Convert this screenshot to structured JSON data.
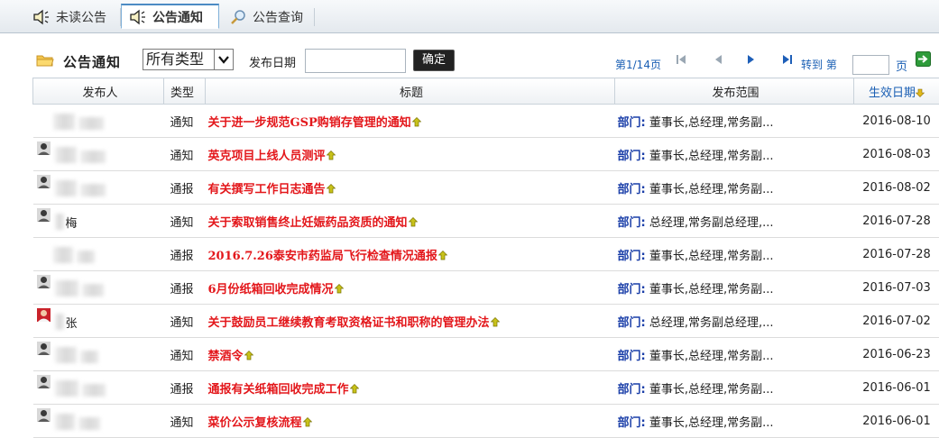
{
  "tabs": [
    {
      "label": "未读公告",
      "icon": "speaker-icon",
      "active": false
    },
    {
      "label": "公告通知",
      "icon": "speaker-icon",
      "active": true
    },
    {
      "label": "公告查询",
      "icon": "search-icon",
      "active": false
    }
  ],
  "toolbar": {
    "section_title": "公告通知",
    "type_select_value": "所有类型",
    "date_label": "发布日期",
    "date_value": "",
    "confirm_label": "确定",
    "page_info": "第1/14页",
    "goto_label": "转到 第",
    "page_value": "",
    "page_suffix": "页"
  },
  "table": {
    "headers": {
      "publisher": "发布人",
      "type": "类型",
      "title": "标题",
      "range": "发布范围",
      "date": "生效日期"
    },
    "rows": [
      {
        "publisher": "",
        "avatar": false,
        "type": "通知",
        "title": "关于进一步规范GSP购销存管理的通知",
        "range_label": "部门:",
        "range": "董事长,总经理,常务副...",
        "date": "2016-08-10"
      },
      {
        "publisher": "",
        "avatar": true,
        "type": "通知",
        "title": "英克项目上线人员测评",
        "range_label": "部门:",
        "range": "董事长,总经理,常务副...",
        "date": "2016-08-03"
      },
      {
        "publisher": "",
        "avatar": true,
        "type": "通报",
        "title": "有关撰写工作日志通告",
        "range_label": "部门:",
        "range": "董事长,总经理,常务副...",
        "date": "2016-08-02"
      },
      {
        "publisher": "梅",
        "avatar": true,
        "type": "通知",
        "title": "关于索取销售终止妊娠药品资质的通知",
        "range_label": "部门:",
        "range": "总经理,常务副总经理,...",
        "date": "2016-07-28"
      },
      {
        "publisher": "",
        "avatar": false,
        "type": "通报",
        "title": "2016.7.26泰安市药监局飞行检查情况通报",
        "range_label": "部门:",
        "range": "董事长,总经理,常务副...",
        "date": "2016-07-28"
      },
      {
        "publisher": "",
        "avatar": true,
        "type": "通报",
        "title": "6月份纸箱回收完成情况",
        "range_label": "部门:",
        "range": "董事长,总经理,常务副...",
        "date": "2016-07-03"
      },
      {
        "publisher": "张",
        "avatar": true,
        "type": "通知",
        "title": "关于鼓励员工继续教育考取资格证书和职称的管理办法",
        "range_label": "部门:",
        "range": "总经理,常务副总经理,...",
        "date": "2016-07-02"
      },
      {
        "publisher": "",
        "avatar": true,
        "type": "通知",
        "title": "禁酒令",
        "range_label": "部门:",
        "range": "董事长,总经理,常务副...",
        "date": "2016-06-23"
      },
      {
        "publisher": "",
        "avatar": true,
        "type": "通报",
        "title": "通报有关纸箱回收完成工作",
        "range_label": "部门:",
        "range": "董事长,总经理,常务副...",
        "date": "2016-06-01"
      },
      {
        "publisher": "",
        "avatar": true,
        "type": "通知",
        "title": "菜价公示复核流程",
        "range_label": "部门:",
        "range": "董事长,总经理,常务副...",
        "date": "2016-06-01"
      }
    ]
  },
  "colors": {
    "title_red": "#e3171b",
    "link_blue": "#1a5fb4",
    "range_blue": "#1a3ea8"
  }
}
